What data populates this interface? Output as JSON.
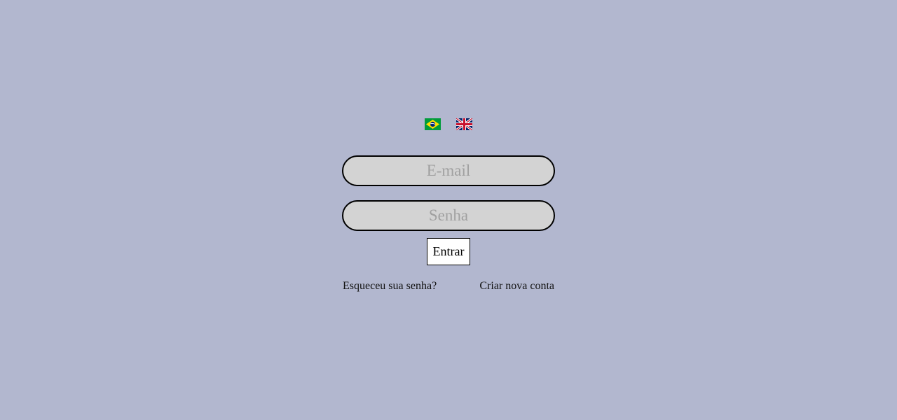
{
  "languages": [
    {
      "code": "pt-BR",
      "icon": "brazil-flag-icon"
    },
    {
      "code": "en-GB",
      "icon": "uk-flag-icon"
    }
  ],
  "form": {
    "email_placeholder": "E-mail",
    "email_value": "",
    "password_placeholder": "Senha",
    "password_value": "",
    "submit_label": "Entrar"
  },
  "links": {
    "forgot_password": "Esqueceu sua senha?",
    "create_account": "Criar nova conta"
  },
  "colors": {
    "background": "#b2b7cf",
    "input_fill": "#d3d3d3",
    "input_border": "#000000",
    "placeholder": "#a0a0a0",
    "button_fill": "#ffffff"
  }
}
